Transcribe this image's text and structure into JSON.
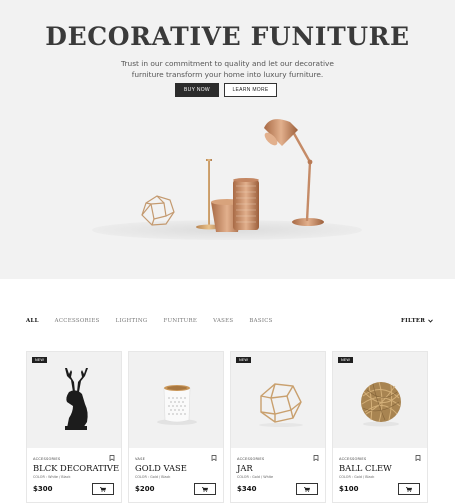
{
  "hero": {
    "title": "DECORATIVE FUNITURE",
    "subtitle": "Trust in our commitment to quality and let our decorative furniture transform your home into luxury furniture.",
    "buy_label": "BUY NOW",
    "learn_label": "LEARN MORE"
  },
  "filters": {
    "tabs": [
      "ALL",
      "ACCESSORIES",
      "LIGHTING",
      "FUNITURE",
      "VASES",
      "BASICS"
    ],
    "active": "ALL",
    "filter_label": "FILTER"
  },
  "products": [
    {
      "badge": "NEW",
      "category": "ACCESSORIES",
      "name": "BLCK DECORATIVE",
      "color": "COLOR : White / Black",
      "price": "$300",
      "image": "deer-head-sculpture"
    },
    {
      "badge": "",
      "category": "VASE",
      "name": "GOLD VASE",
      "color": "COLOR : Gold / Black",
      "price": "$200",
      "image": "white-gold-vase"
    },
    {
      "badge": "NEW",
      "category": "ACCESSORIES",
      "name": "JAR",
      "color": "COLOR : Gold / White",
      "price": "$340",
      "image": "geometric-gold-jar"
    },
    {
      "badge": "NEW",
      "category": "ACCESSORIES",
      "name": "BALL CLEW",
      "color": "COLOR : Gold / Black",
      "price": "$100",
      "image": "wicker-ball"
    }
  ],
  "colors": {
    "accent": "#2b2b2b",
    "copper": "#c98b63",
    "hero_bg": "#f2f2f2"
  }
}
